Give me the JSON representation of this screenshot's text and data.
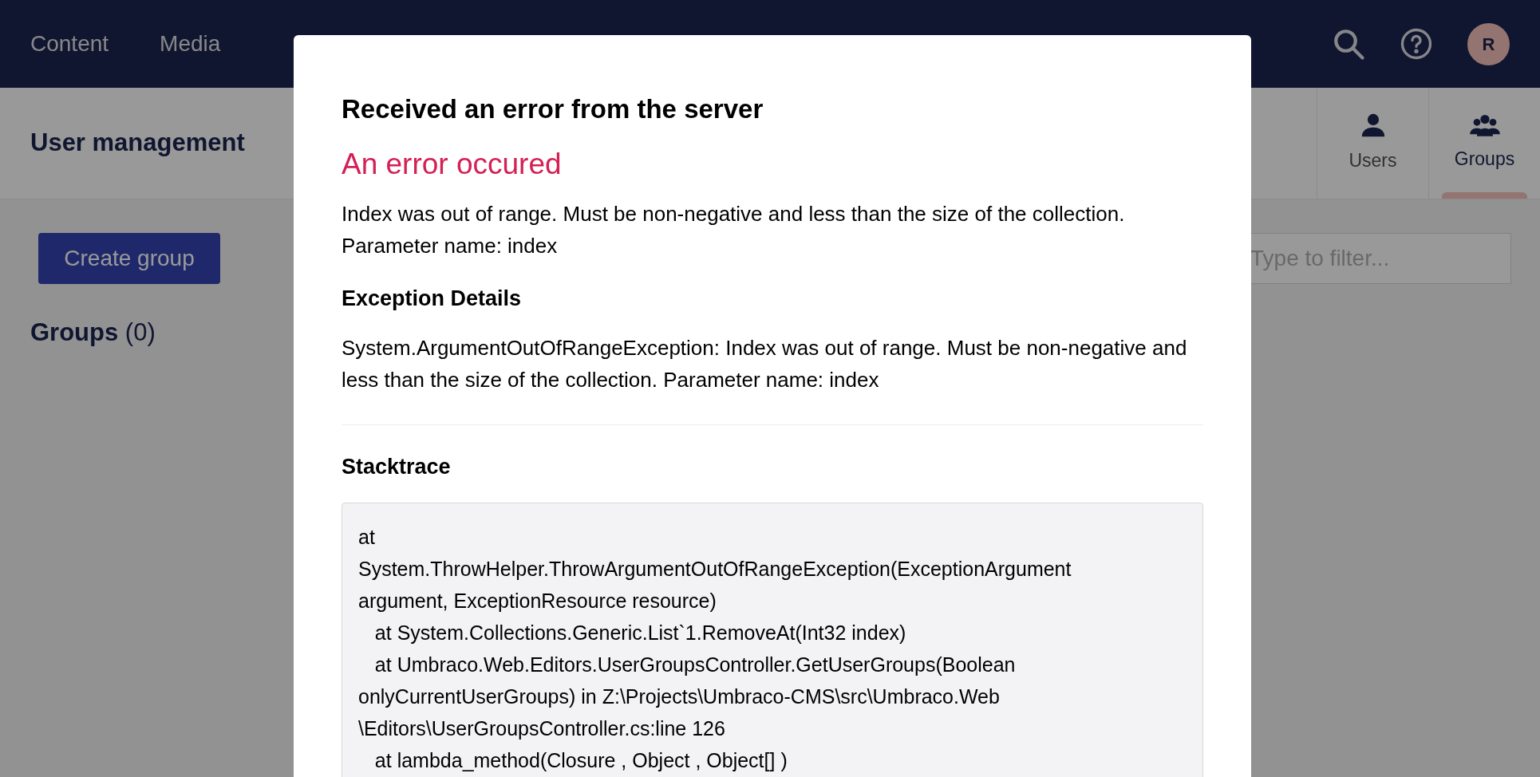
{
  "top_nav": {
    "sections": [
      {
        "label": "Content",
        "selected": false
      },
      {
        "label": "Media",
        "selected": false
      }
    ],
    "avatar_initial": "R"
  },
  "page": {
    "title": "User management",
    "tabs": [
      {
        "label": "Users",
        "kind": "user",
        "selected": false
      },
      {
        "label": "Groups",
        "kind": "group",
        "selected": true
      }
    ],
    "create_button": "Create group",
    "filter": {
      "placeholder": "Type to filter..."
    },
    "groups_label": "Groups",
    "groups_count": "(0)"
  },
  "dialog": {
    "title": "Received an error from the server",
    "error_heading": "An error occured",
    "message": "Index was out of range. Must be non-negative and less than the size of the collection. Parameter name: index",
    "details_heading": "Exception Details",
    "details": "System.ArgumentOutOfRangeException: Index was out of range. Must be non-negative and less than the size of the collection. Parameter name: index",
    "stacktrace_heading": "Stacktrace",
    "stacktrace": [
      "at",
      "System.ThrowHelper.ThrowArgumentOutOfRangeException(ExceptionArgument",
      "argument, ExceptionResource resource)",
      "   at System.Collections.Generic.List`1.RemoveAt(Int32 index)",
      "   at Umbraco.Web.Editors.UserGroupsController.GetUserGroups(Boolean",
      "onlyCurrentUserGroups) in Z:\\Projects\\Umbraco-CMS\\src\\Umbraco.Web",
      "\\Editors\\UserGroupsController.cs:line 126",
      "   at lambda_method(Closure , Object , Object[] )"
    ]
  }
}
